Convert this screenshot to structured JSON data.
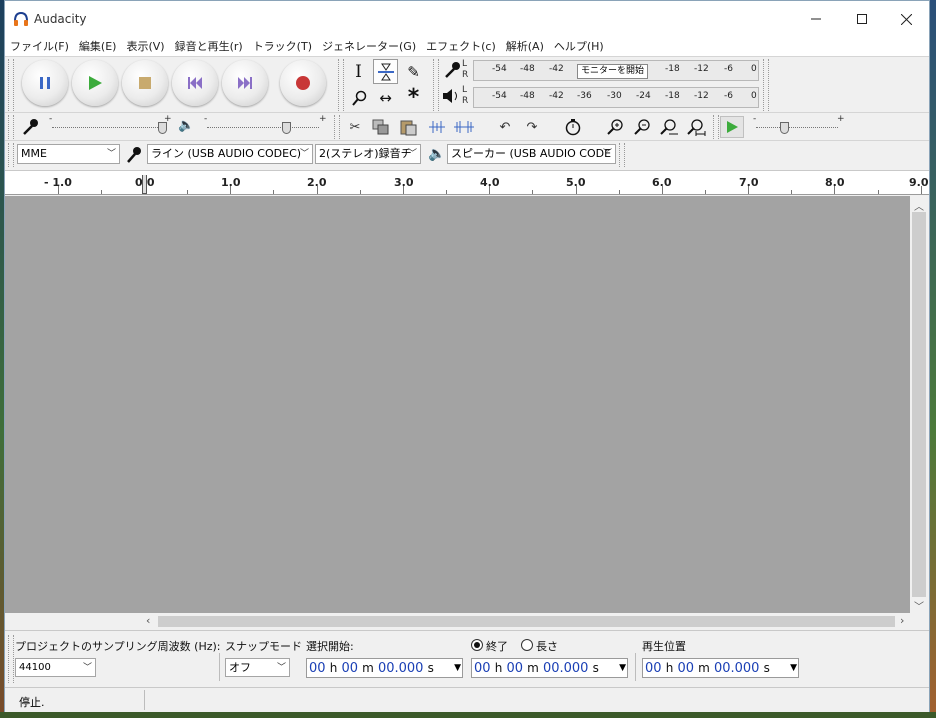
{
  "window": {
    "title": "Audacity"
  },
  "menu": [
    "ファイル(F)",
    "編集(E)",
    "表示(V)",
    "録音と再生(r)",
    "トラック(T)",
    "ジェネレーター(G)",
    "エフェクト(c)",
    "解析(A)",
    "ヘルプ(H)"
  ],
  "meters": {
    "record_scale": [
      "-54",
      "-48",
      "-42",
      "-18",
      "-12",
      "-6",
      "0"
    ],
    "monitor_label": "モニターを開始",
    "play_scale": [
      "-54",
      "-48",
      "-42",
      "-36",
      "-30",
      "-24",
      "-18",
      "-12",
      "-6",
      "0"
    ],
    "channel_left": "L",
    "channel_right": "R"
  },
  "devices": {
    "host": "MME",
    "recording_device": "ライン (USB AUDIO  CODEC)",
    "channels": "2(ステレオ)録音チ",
    "playback_device": "スピーカー (USB AUDIO  CODE"
  },
  "ruler": {
    "labels": [
      "- 1.0",
      "0.0",
      "1.0",
      "2.0",
      "3.0",
      "4.0",
      "5.0",
      "6.0",
      "7.0",
      "8.0",
      "9.0"
    ]
  },
  "selection": {
    "rate_label": "プロジェクトのサンプリング周波数 (Hz):",
    "rate_value": "44100",
    "snap_label": "スナップモード",
    "snap_value": "オフ",
    "start_label": "選択開始:",
    "end_label": "終了",
    "length_label": "長さ",
    "end_selected": true,
    "position_label": "再生位置",
    "time_h": "00",
    "time_h_unit": "h",
    "time_m": "00",
    "time_m_unit": "m",
    "time_s": "00.000",
    "time_s_unit": "s"
  },
  "status": {
    "text": "停止."
  },
  "colors": {
    "track_area": "#a3a3a3",
    "time_digits": "#1a3fb5",
    "play_green": "#3cab3c",
    "record_red": "#c83737",
    "pause_blue": "#3b68c5"
  }
}
